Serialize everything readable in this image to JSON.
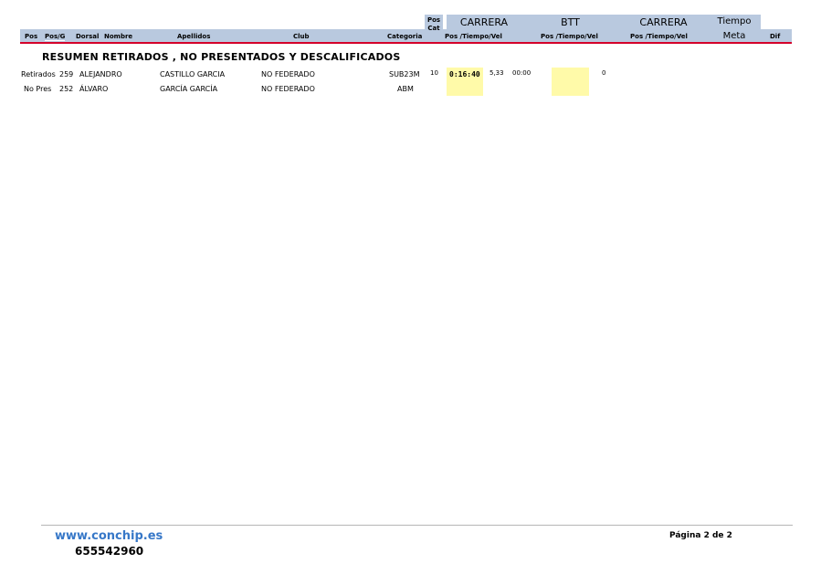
{
  "header": {
    "group_titles": {
      "carrera1": "CARRERA",
      "btt": "BTT",
      "carrera2": "CARRERA",
      "tiempo": "Tiempo"
    },
    "pos_cat_line1": "Pos",
    "pos_cat_line2": "Cat",
    "meta": "Meta",
    "columns": {
      "pos": "Pos",
      "posg": "Pos/G",
      "dorsal": "Dorsal",
      "nombre": "Nombre",
      "apellidos": "Apellidos",
      "club": "Club",
      "categoria": "Categoria",
      "carrera1_sub": "Pos /Tiempo/Vel",
      "btt_sub": "Pos /Tiempo/Vel",
      "carrera2_sub": "Pos /Tiempo/Vel",
      "dif": "Dif"
    }
  },
  "section_title": "RESUMEN RETIRADOS , NO PRESENTADOS Y DESCALIFICADOS",
  "rows": [
    {
      "status": "Retirados",
      "dorsal": "259",
      "nombre": "ALEJANDRO",
      "apellidos": "CASTILLO GARCIA",
      "club": "NO FEDERADO",
      "categoria": "SUB23M",
      "pos_cat": "10",
      "carrera1_tiempo": "0:16:40",
      "carrera1_vel": "5,33",
      "carrera1_extra": "00:00",
      "btt_extra": "0"
    },
    {
      "status": "No Pres",
      "dorsal": "252",
      "nombre": "ÁLVARO",
      "apellidos": "GARCÍA GARCÍA",
      "club": "NO FEDERADO",
      "categoria": "ABM"
    }
  ],
  "footer": {
    "website": "www.conchip.es",
    "phone": "655542960",
    "page": "Página 2 de 2"
  }
}
